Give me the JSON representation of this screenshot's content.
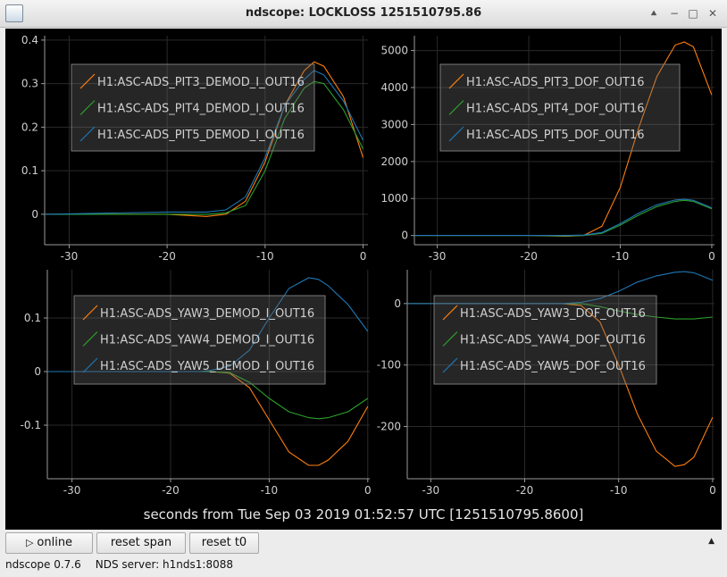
{
  "window": {
    "title": "ndscope: LOCKLOSS 1251510795.86",
    "controls": [
      "up-icon",
      "minimize-icon",
      "maximize-icon",
      "close-icon"
    ]
  },
  "toolbar": {
    "online_label": "online",
    "reset_span_label": "reset span",
    "reset_t0_label": "reset t0"
  },
  "status": {
    "version": "ndscope 0.7.6",
    "server": "NDS server: h1nds1:8088"
  },
  "x_axis_caption": "seconds from Tue Sep 03 2019 01:52:57 UTC [1251510795.8600]",
  "colors": {
    "orange": "#ff7f0e",
    "green": "#2ca02c",
    "blue": "#1f77b4",
    "background": "#000000"
  },
  "chart_data": [
    {
      "type": "line",
      "xlim": [
        -32.5,
        0.5
      ],
      "ylim": [
        -0.07,
        0.41
      ],
      "xticks": [
        -30,
        -20,
        -10,
        0
      ],
      "yticks": [
        0,
        0.1,
        0.2,
        0.3,
        0.4
      ],
      "ytick_labels": [
        "0",
        "0.1",
        "0.2",
        "0.3",
        "0.4"
      ],
      "x": [
        -32.5,
        -20,
        -16,
        -14,
        -12,
        -10,
        -8,
        -6,
        -5,
        -4,
        -2,
        0
      ],
      "series": [
        {
          "name": "H1:ASC-ADS_PIT3_DEMOD_I_OUT16",
          "color": "#ff7f0e",
          "values": [
            0,
            0,
            -0.005,
            0,
            0.03,
            0.12,
            0.25,
            0.33,
            0.35,
            0.34,
            0.27,
            0.13
          ]
        },
        {
          "name": "H1:ASC-ADS_PIT4_DEMOD_I_OUT16",
          "color": "#2ca02c",
          "values": [
            0,
            0,
            0,
            0.003,
            0.02,
            0.1,
            0.22,
            0.29,
            0.305,
            0.3,
            0.24,
            0.15
          ]
        },
        {
          "name": "H1:ASC-ADS_PIT5_DEMOD_I_OUT16",
          "color": "#1f77b4",
          "values": [
            0,
            0.005,
            0.005,
            0.01,
            0.04,
            0.13,
            0.25,
            0.31,
            0.33,
            0.32,
            0.26,
            0.17
          ]
        }
      ],
      "grid": true,
      "legend_position": "top-center"
    },
    {
      "type": "line",
      "xlim": [
        -32.5,
        0.3
      ],
      "ylim": [
        -250,
        5400
      ],
      "xticks": [
        -30,
        -20,
        -10,
        0
      ],
      "yticks": [
        0,
        1000,
        2000,
        3000,
        4000,
        5000
      ],
      "ytick_labels": [
        "0",
        "1000",
        "2000",
        "3000",
        "4000",
        "5000"
      ],
      "x": [
        -32.5,
        -20,
        -16,
        -14,
        -12,
        -10,
        -8,
        -6,
        -4,
        -3,
        -2,
        0
      ],
      "series": [
        {
          "name": "H1:ASC-ADS_PIT3_DOF_OUT16",
          "color": "#ff7f0e",
          "values": [
            0,
            0,
            -20,
            0,
            250,
            1300,
            2900,
            4300,
            5150,
            5230,
            5100,
            3800
          ]
        },
        {
          "name": "H1:ASC-ADS_PIT4_DOF_OUT16",
          "color": "#2ca02c",
          "values": [
            0,
            0,
            -10,
            0,
            60,
            280,
            550,
            780,
            920,
            950,
            920,
            720
          ]
        },
        {
          "name": "H1:ASC-ADS_PIT5_DOF_OUT16",
          "color": "#1f77b4",
          "values": [
            0,
            0,
            0,
            10,
            80,
            320,
            600,
            830,
            960,
            980,
            950,
            750
          ]
        }
      ],
      "grid": true,
      "legend_position": "top-center"
    },
    {
      "type": "line",
      "xlim": [
        -32.5,
        0.2
      ],
      "ylim": [
        -0.2,
        0.19
      ],
      "xticks": [
        -30,
        -20,
        -10,
        0
      ],
      "yticks": [
        -0.1,
        0,
        0.1
      ],
      "ytick_labels": [
        "-0.1",
        "0",
        "0.1"
      ],
      "x": [
        -32.5,
        -20,
        -17,
        -16,
        -14,
        -12,
        -10,
        -8,
        -6,
        -5,
        -4,
        -2,
        0
      ],
      "series": [
        {
          "name": "H1:ASC-ADS_YAW3_DEMOD_I_OUT16",
          "color": "#ff7f0e",
          "values": [
            0,
            0,
            0,
            0,
            -0.003,
            -0.03,
            -0.09,
            -0.15,
            -0.175,
            -0.175,
            -0.165,
            -0.13,
            -0.065
          ]
        },
        {
          "name": "H1:ASC-ADS_YAW4_DEMOD_I_OUT16",
          "color": "#2ca02c",
          "values": [
            0,
            0,
            0,
            0,
            -0.002,
            -0.02,
            -0.05,
            -0.075,
            -0.086,
            -0.088,
            -0.086,
            -0.075,
            -0.05
          ]
        },
        {
          "name": "H1:ASC-ADS_YAW5_DEMOD_I_OUT16",
          "color": "#1f77b4",
          "values": [
            0,
            0,
            0,
            0.002,
            0.01,
            0.04,
            0.1,
            0.155,
            0.175,
            0.172,
            0.16,
            0.125,
            0.075
          ]
        }
      ],
      "grid": true,
      "legend_position": "top-center"
    },
    {
      "type": "line",
      "xlim": [
        -32.5,
        0.2
      ],
      "ylim": [
        -285,
        55
      ],
      "xticks": [
        -30,
        -20,
        -10,
        0
      ],
      "yticks": [
        -200,
        -100,
        0
      ],
      "ytick_labels": [
        "-200",
        "-100",
        "0"
      ],
      "x": [
        -32.5,
        -20,
        -16,
        -14,
        -12,
        -10,
        -8,
        -6,
        -4,
        -3,
        -2,
        0
      ],
      "series": [
        {
          "name": "H1:ASC-ADS_YAW3_DOF_OUT16",
          "color": "#ff7f0e",
          "values": [
            0,
            0,
            0,
            -3,
            -30,
            -100,
            -180,
            -240,
            -265,
            -262,
            -250,
            -185
          ]
        },
        {
          "name": "H1:ASC-ADS_YAW4_DOF_OUT16",
          "color": "#2ca02c",
          "values": [
            0,
            0,
            0,
            0,
            -5,
            -12,
            -18,
            -22,
            -25,
            -25,
            -25,
            -22
          ]
        },
        {
          "name": "H1:ASC-ADS_YAW5_DOF_OUT16",
          "color": "#1f77b4",
          "values": [
            0,
            0,
            0,
            2,
            8,
            20,
            35,
            45,
            51,
            52,
            50,
            38
          ]
        }
      ],
      "grid": true,
      "legend_position": "top-center"
    }
  ]
}
